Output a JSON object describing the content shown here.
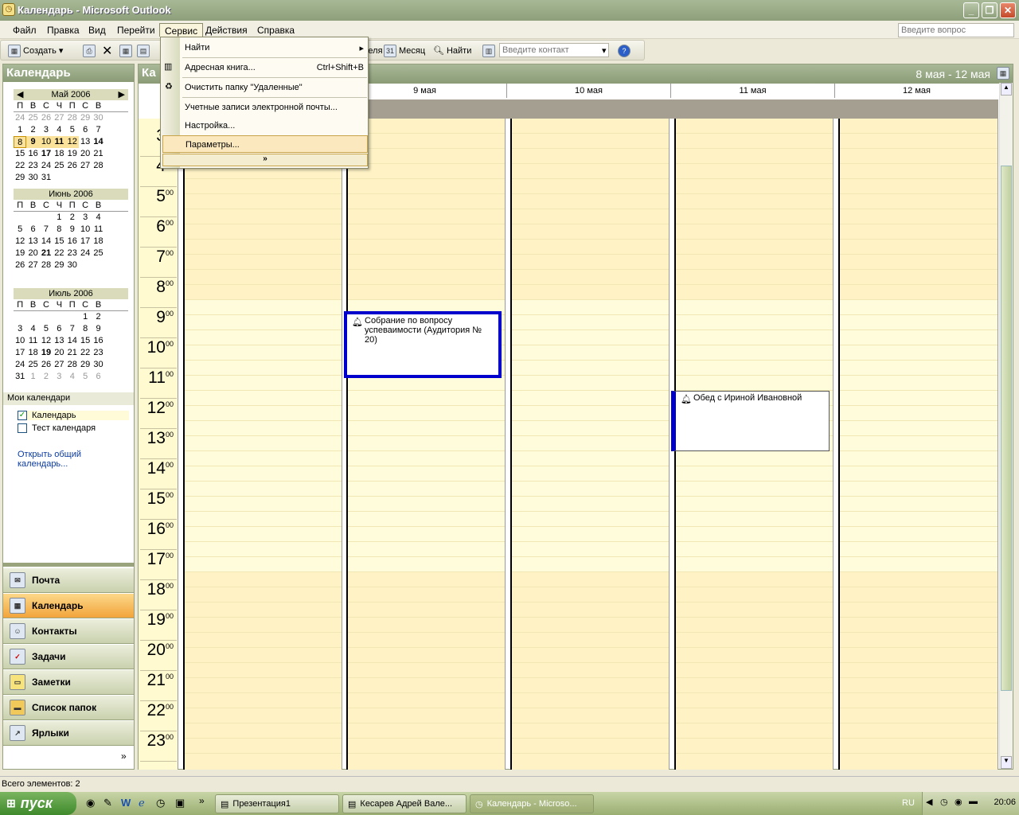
{
  "window": {
    "title": "Календарь - Microsoft Outlook"
  },
  "menubar": {
    "items": [
      "Файл",
      "Правка",
      "Вид",
      "Перейти",
      "Сервис",
      "Действия",
      "Справка"
    ],
    "ask_placeholder": "Введите вопрос"
  },
  "toolbar": {
    "create_label": "Создать",
    "view_week_label": "деля",
    "month_label": "Месяц",
    "find_label": "Найти",
    "contact_placeholder": "Введите контакт"
  },
  "tools_menu": {
    "items": [
      {
        "label": "Найти",
        "shortcut": "",
        "submenu": true
      },
      {
        "label": "Адресная книга...",
        "shortcut": "Ctrl+Shift+B"
      },
      {
        "label": "Очистить папку \"Удаленные\"",
        "shortcut": ""
      },
      {
        "label": "Учетные записи электронной почты...",
        "shortcut": ""
      },
      {
        "label": "Настройка...",
        "shortcut": ""
      },
      {
        "label": "Параметры...",
        "shortcut": ""
      }
    ],
    "expand_glyph": "»"
  },
  "navpane": {
    "title": "Календарь",
    "months": [
      {
        "name": "Май 2006",
        "rows": [
          [
            "24",
            "25",
            "26",
            "27",
            "28",
            "29",
            "30"
          ],
          [
            "1",
            "2",
            "3",
            "4",
            "5",
            "6",
            "7"
          ],
          [
            "8",
            "9",
            "10",
            "11",
            "12",
            "13",
            "14"
          ],
          [
            "15",
            "16",
            "17",
            "18",
            "19",
            "20",
            "21"
          ],
          [
            "22",
            "23",
            "24",
            "25",
            "26",
            "27",
            "28"
          ],
          [
            "29",
            "30",
            "31",
            "",
            "",
            "",
            ""
          ]
        ]
      },
      {
        "name": "Июнь 2006",
        "rows": [
          [
            "",
            "",
            "",
            "1",
            "2",
            "3",
            "4"
          ],
          [
            "5",
            "6",
            "7",
            "8",
            "9",
            "10",
            "11"
          ],
          [
            "12",
            "13",
            "14",
            "15",
            "16",
            "17",
            "18"
          ],
          [
            "19",
            "20",
            "21",
            "22",
            "23",
            "24",
            "25"
          ],
          [
            "26",
            "27",
            "28",
            "29",
            "30",
            "",
            ""
          ]
        ]
      },
      {
        "name": "Июль 2006",
        "rows": [
          [
            "",
            "",
            "",
            "",
            "",
            "1",
            "2"
          ],
          [
            "3",
            "4",
            "5",
            "6",
            "7",
            "8",
            "9"
          ],
          [
            "10",
            "11",
            "12",
            "13",
            "14",
            "15",
            "16"
          ],
          [
            "17",
            "18",
            "19",
            "20",
            "21",
            "22",
            "23"
          ],
          [
            "24",
            "25",
            "26",
            "27",
            "28",
            "29",
            "30"
          ],
          [
            "31",
            "1",
            "2",
            "3",
            "4",
            "5",
            "6"
          ]
        ]
      }
    ],
    "dow": [
      "П",
      "В",
      "С",
      "Ч",
      "П",
      "С",
      "В"
    ],
    "my_calendars_label": "Мои календари",
    "calendars": [
      {
        "label": "Календарь",
        "checked": true
      },
      {
        "label": "Тест календаря",
        "checked": false
      }
    ],
    "open_shared_label": "Открыть общий календарь...",
    "buttons": [
      "Почта",
      "Календарь",
      "Контакты",
      "Задачи",
      "Заметки",
      "Список папок",
      "Ярлыки"
    ],
    "more_glyph": "»"
  },
  "calendar": {
    "header_title": "Ка",
    "date_range": "8 мая  - 12 мая",
    "days": [
      "9 мая",
      "10 мая",
      "11 мая",
      "12 мая"
    ],
    "hours": [
      "3",
      "4",
      "5",
      "6",
      "7",
      "8",
      "9",
      "10",
      "11",
      "12",
      "13",
      "14",
      "15",
      "16",
      "17",
      "18",
      "19",
      "20",
      "21",
      "22",
      "23"
    ],
    "minutes_sup": "00",
    "appointments": [
      {
        "title": "Собрание по вопросу успеваимости (Аудитория № 20)"
      },
      {
        "title": "Обед с Ириной Ивановной"
      }
    ]
  },
  "statusbar": {
    "text": "Всего элементов: 2"
  },
  "taskbar": {
    "start_label": "пуск",
    "tasks": [
      "Презентация1",
      "Кесарев Адрей Вале...",
      "Календарь - Microso..."
    ],
    "lang": "RU",
    "clock": "20:06"
  },
  "colors": {
    "accent": "#8a9b76",
    "selected_day": "#fbe29a",
    "appointment_border": "#0000cc"
  }
}
